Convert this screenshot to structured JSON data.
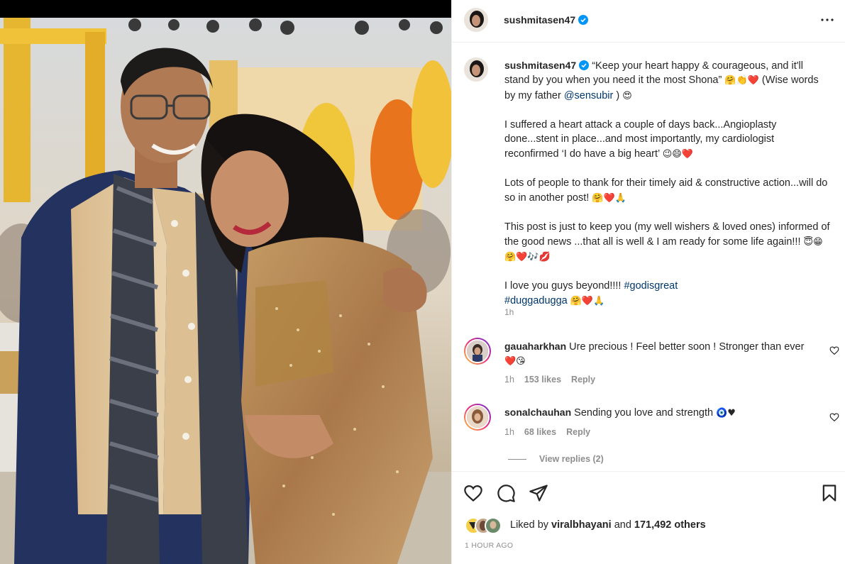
{
  "post": {
    "username": "sushmitasen47",
    "more_icon": "more-horizontal-icon"
  },
  "caption": {
    "username": "sushmitasen47",
    "line1_a": "“Keep your heart happy & courageous, and it'll stand by you when you need it the most Shona”",
    "line1_emoji": "🤗👏❤️",
    "line1_b": " (Wise words by my father ",
    "mention": "@sensubir",
    "line1_c": " )",
    "line1_emoji2": "😍",
    "para2": "I suffered a heart attack a couple of days back...Angioplasty done...stent in place...and most importantly, my cardiologist reconfirmed ‘I do have a big heart’",
    "para2_emoji": "😉😄❤️",
    "para3": "Lots of people to thank for their timely aid & constructive action...will do so in another post!",
    "para3_emoji": "🤗❤️🙏",
    "para4": "This post is just to keep you (my well wishers & loved ones) informed of the good news ...that all is well & I am ready for some life again!!!",
    "para4_emoji": "😇😁🤗❤️🎶💋",
    "para5": "I love you guys beyond!!!! ",
    "hashtag1": "#godisgreat",
    "hashtag2": "#duggadugga",
    "para5_emoji": "🤗❤️🙏",
    "time": "1h"
  },
  "comments": [
    {
      "username": "gauaharkhan",
      "text": "Ure precious ! Feel better soon ! Stronger than ever",
      "emoji": "❤️😘",
      "time": "1h",
      "likes": "153 likes",
      "reply": "Reply"
    },
    {
      "username": "sonalchauhan",
      "text": "Sending you love and strength",
      "emoji": "🧿♥",
      "time": "1h",
      "likes": "68 likes",
      "reply": "Reply"
    }
  ],
  "view_replies": "View replies (2)",
  "actions": {
    "like_icon": "heart-icon",
    "comment_icon": "comment-icon",
    "share_icon": "share-icon",
    "save_icon": "bookmark-icon"
  },
  "likes": {
    "prefix": "Liked by ",
    "user": "viralbhayani",
    "middle": " and ",
    "count": "171,492 others"
  },
  "post_time": "1 HOUR AGO",
  "colors": {
    "link": "#00376b",
    "verified": "#0095f6",
    "secondary_text": "#8e8e8e",
    "heart_red": "#ed4956"
  }
}
